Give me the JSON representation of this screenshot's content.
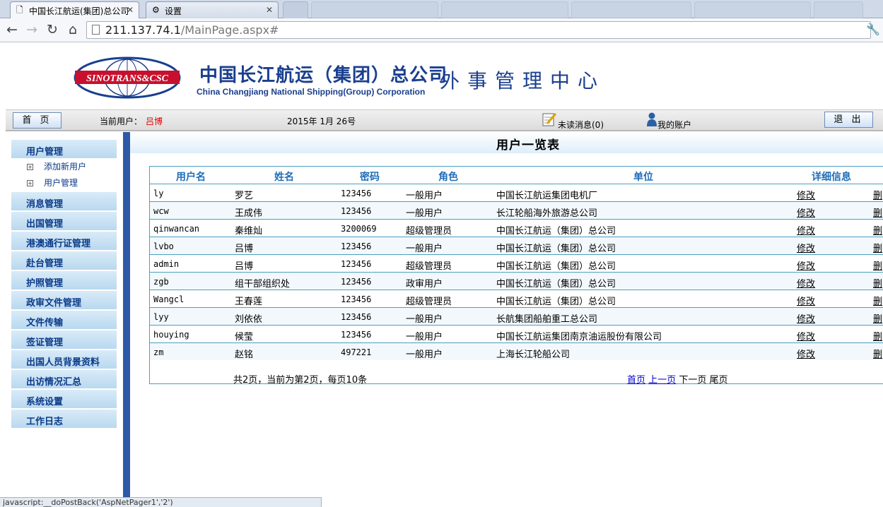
{
  "browser": {
    "tabs": [
      {
        "title": "中国长江航运(集团)总公司",
        "active": true
      },
      {
        "title": "设置",
        "active": false
      }
    ],
    "url_host": "211.137.74.1",
    "url_path": "/MainPage.aspx#",
    "status_text": "javascript:__doPostBack('AspNetPager1','2')"
  },
  "header": {
    "logo_text": "SINOTRANS&CSC",
    "company_cn": "中国长江航运（集团）总公司",
    "company_en": "China Changjiang National Shipping(Group) Corporation",
    "center_title": "外事管理中心"
  },
  "topbar": {
    "home_label": "首 页",
    "current_user_label": "当前用户：",
    "current_user": "吕博",
    "date": "2015年 1月 26号",
    "unread_label": "未读消息(0)",
    "account_label": "我的账户",
    "logout_label": "退 出"
  },
  "leftnav": {
    "items": [
      "用户管理",
      "消息管理",
      "出国管理",
      "港澳通行证管理",
      "赴台管理",
      "护照管理",
      "政审文件管理",
      "文件传输",
      "签证管理",
      "出国人员背景资料",
      "出访情况汇总",
      "系统设置",
      "工作日志"
    ],
    "subitems": [
      "添加新用户",
      "用户管理"
    ],
    "expand_symbol": "+"
  },
  "content": {
    "title": "用户一览表",
    "columns": [
      "用户名",
      "姓名",
      "密码",
      "角色",
      "单位",
      "详细信息"
    ],
    "rows": [
      {
        "username": "ly",
        "name": "罗艺",
        "password": "123456",
        "role": "一般用户",
        "unit": "中国长江航运集团电机厂",
        "detail": "修改",
        "del": "删"
      },
      {
        "username": "wcw",
        "name": "王成伟",
        "password": "123456",
        "role": "一般用户",
        "unit": "长江轮船海外旅游总公司",
        "detail": "修改",
        "del": "删"
      },
      {
        "username": "qinwancan",
        "name": "秦维灿",
        "password": "3200069",
        "role": "超级管理员",
        "unit": "中国长江航运（集团）总公司",
        "detail": "修改",
        "del": "删"
      },
      {
        "username": "lvbo",
        "name": "吕博",
        "password": "123456",
        "role": "一般用户",
        "unit": "中国长江航运（集团）总公司",
        "detail": "修改",
        "del": "删"
      },
      {
        "username": "admin",
        "name": "吕博",
        "password": "123456",
        "role": "超级管理员",
        "unit": "中国长江航运（集团）总公司",
        "detail": "修改",
        "del": "删"
      },
      {
        "username": "zgb",
        "name": "组干部组织处",
        "password": "123456",
        "role": "政审用户",
        "unit": "中国长江航运（集团）总公司",
        "detail": "修改",
        "del": "删"
      },
      {
        "username": "Wangcl",
        "name": "王春莲",
        "password": "123456",
        "role": "超级管理员",
        "unit": "中国长江航运（集团）总公司",
        "detail": "修改",
        "del": "删"
      },
      {
        "username": "lyy",
        "name": "刘依依",
        "password": "123456",
        "role": "一般用户",
        "unit": "长航集团船舶重工总公司",
        "detail": "修改",
        "del": "删"
      },
      {
        "username": "houying",
        "name": "候莹",
        "password": "123456",
        "role": "一般用户",
        "unit": "中国长江航运集团南京油运股份有限公司",
        "detail": "修改",
        "del": "删"
      },
      {
        "username": "zm",
        "name": "赵铭",
        "password": "497221",
        "role": "一般用户",
        "unit": "上海长江轮船公司",
        "detail": "修改",
        "del": "删"
      }
    ],
    "pager": {
      "summary": "共2页，当前为第2页，每页10条",
      "first": "首页",
      "prev": "上一页",
      "next": "下一页",
      "last": "尾页"
    }
  },
  "colors": {
    "brand_blue": "#1a3f8f",
    "nav_divider": "#2c5aa6",
    "grid_border": "#4a9fbf",
    "header_text": "#1e6db8",
    "logo_red": "#c8102e"
  }
}
